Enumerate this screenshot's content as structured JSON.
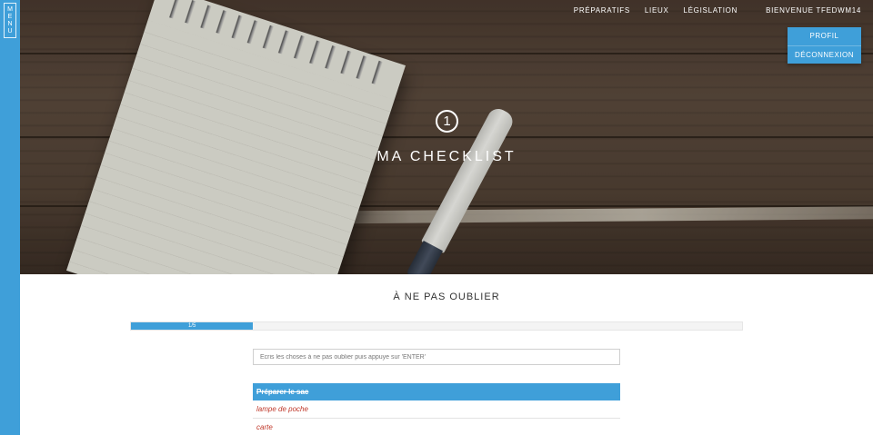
{
  "menu": {
    "label": "MENU"
  },
  "nav": {
    "links": [
      "PRÉPARATIFS",
      "LIEUX",
      "LÉGISLATION"
    ],
    "user_label": "BIENVENUE TFEDWM14",
    "dropdown": [
      "PROFIL",
      "DÉCONNEXION"
    ]
  },
  "hero": {
    "step": "1",
    "title": "MA CHECKLIST"
  },
  "main": {
    "section_title": "À NE PAS OUBLIER",
    "progress": {
      "label": "1/5",
      "completed": 1,
      "total": 5
    },
    "input_placeholder": "Écris les choses à ne pas oublier puis appuye sur 'ENTER'",
    "items": [
      {
        "label": "Préparer le sac",
        "done": true
      },
      {
        "label": "lampe de poche",
        "done": false
      },
      {
        "label": "carte",
        "done": false
      }
    ]
  },
  "colors": {
    "accent": "#3f9fd9",
    "pending_item": "#c0392b"
  }
}
